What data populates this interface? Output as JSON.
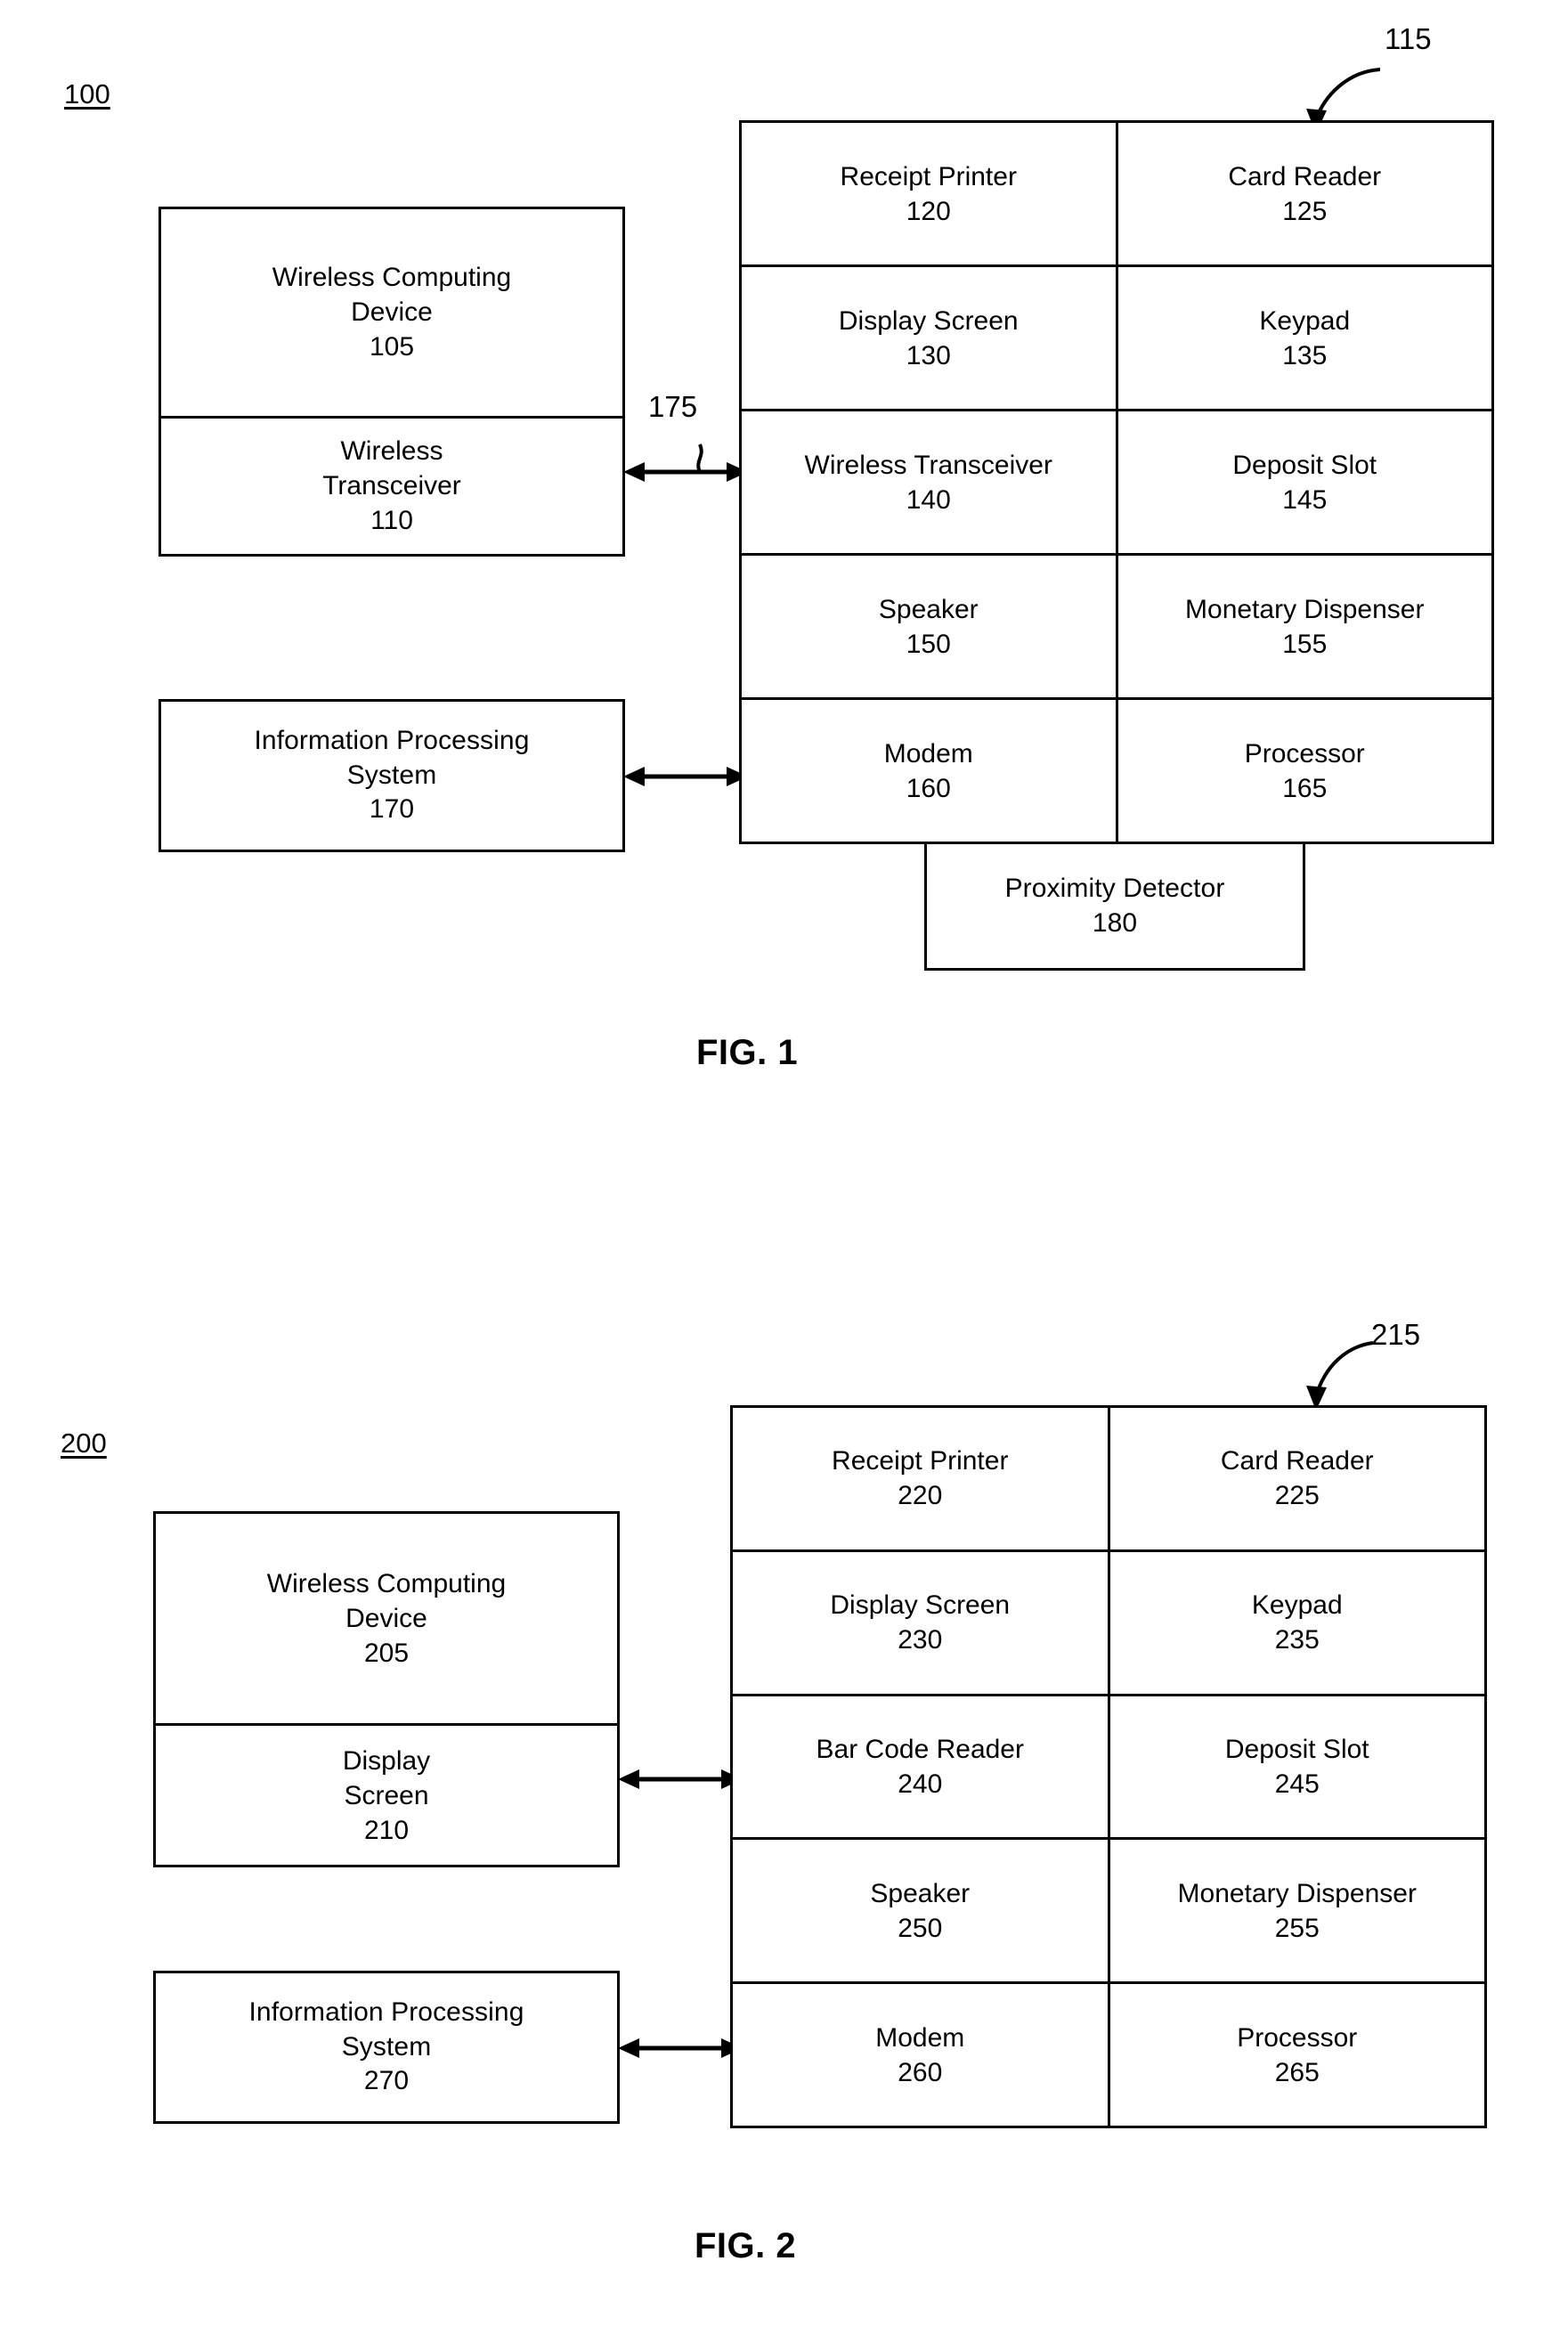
{
  "figures": [
    {
      "id": "fig1",
      "system_ref": "100",
      "terminal_ref": "115",
      "link_ref": "175",
      "caption": "FIG. 1",
      "left_module": {
        "cells": [
          {
            "lines": [
              "Wireless Computing",
              "Device",
              "105"
            ]
          },
          {
            "lines": [
              "Wireless",
              "Transceiver",
              "110"
            ]
          }
        ]
      },
      "processing_box": {
        "lines": [
          "Information Processing",
          "System",
          "170"
        ]
      },
      "grid": {
        "rows": [
          {
            "left": {
              "lines": [
                "Receipt Printer",
                "120"
              ]
            },
            "right": {
              "lines": [
                "Card Reader",
                "125"
              ]
            }
          },
          {
            "left": {
              "lines": [
                "Display Screen",
                "130"
              ]
            },
            "right": {
              "lines": [
                "Keypad",
                "135"
              ]
            }
          },
          {
            "left": {
              "lines": [
                "Wireless Transceiver",
                "140"
              ]
            },
            "right": {
              "lines": [
                "Deposit Slot",
                "145"
              ]
            }
          },
          {
            "left": {
              "lines": [
                "Speaker",
                "150"
              ]
            },
            "right": {
              "lines": [
                "Monetary Dispenser",
                "155"
              ]
            }
          },
          {
            "left": {
              "lines": [
                "Modem",
                "160"
              ]
            },
            "right": {
              "lines": [
                "Processor",
                "165"
              ]
            }
          }
        ]
      },
      "extra_box": {
        "lines": [
          "Proximity Detector",
          "180"
        ]
      }
    },
    {
      "id": "fig2",
      "system_ref": "200",
      "terminal_ref": "215",
      "link_ref": "",
      "caption": "FIG. 2",
      "left_module": {
        "cells": [
          {
            "lines": [
              "Wireless Computing",
              "Device",
              "205"
            ]
          },
          {
            "lines": [
              "Display",
              "Screen",
              "210"
            ]
          }
        ]
      },
      "processing_box": {
        "lines": [
          "Information Processing",
          "System",
          "270"
        ]
      },
      "grid": {
        "rows": [
          {
            "left": {
              "lines": [
                "Receipt Printer",
                "220"
              ]
            },
            "right": {
              "lines": [
                "Card Reader",
                "225"
              ]
            }
          },
          {
            "left": {
              "lines": [
                "Display Screen",
                "230"
              ]
            },
            "right": {
              "lines": [
                "Keypad",
                "235"
              ]
            }
          },
          {
            "left": {
              "lines": [
                "Bar Code Reader",
                "240"
              ]
            },
            "right": {
              "lines": [
                "Deposit Slot",
                "245"
              ]
            }
          },
          {
            "left": {
              "lines": [
                "Speaker",
                "250"
              ]
            },
            "right": {
              "lines": [
                "Monetary Dispenser",
                "255"
              ]
            }
          },
          {
            "left": {
              "lines": [
                "Modem",
                "260"
              ]
            },
            "right": {
              "lines": [
                "Processor",
                "265"
              ]
            }
          }
        ]
      },
      "extra_box": null
    }
  ],
  "colors": {
    "ink": "#000000",
    "paper": "#ffffff"
  }
}
